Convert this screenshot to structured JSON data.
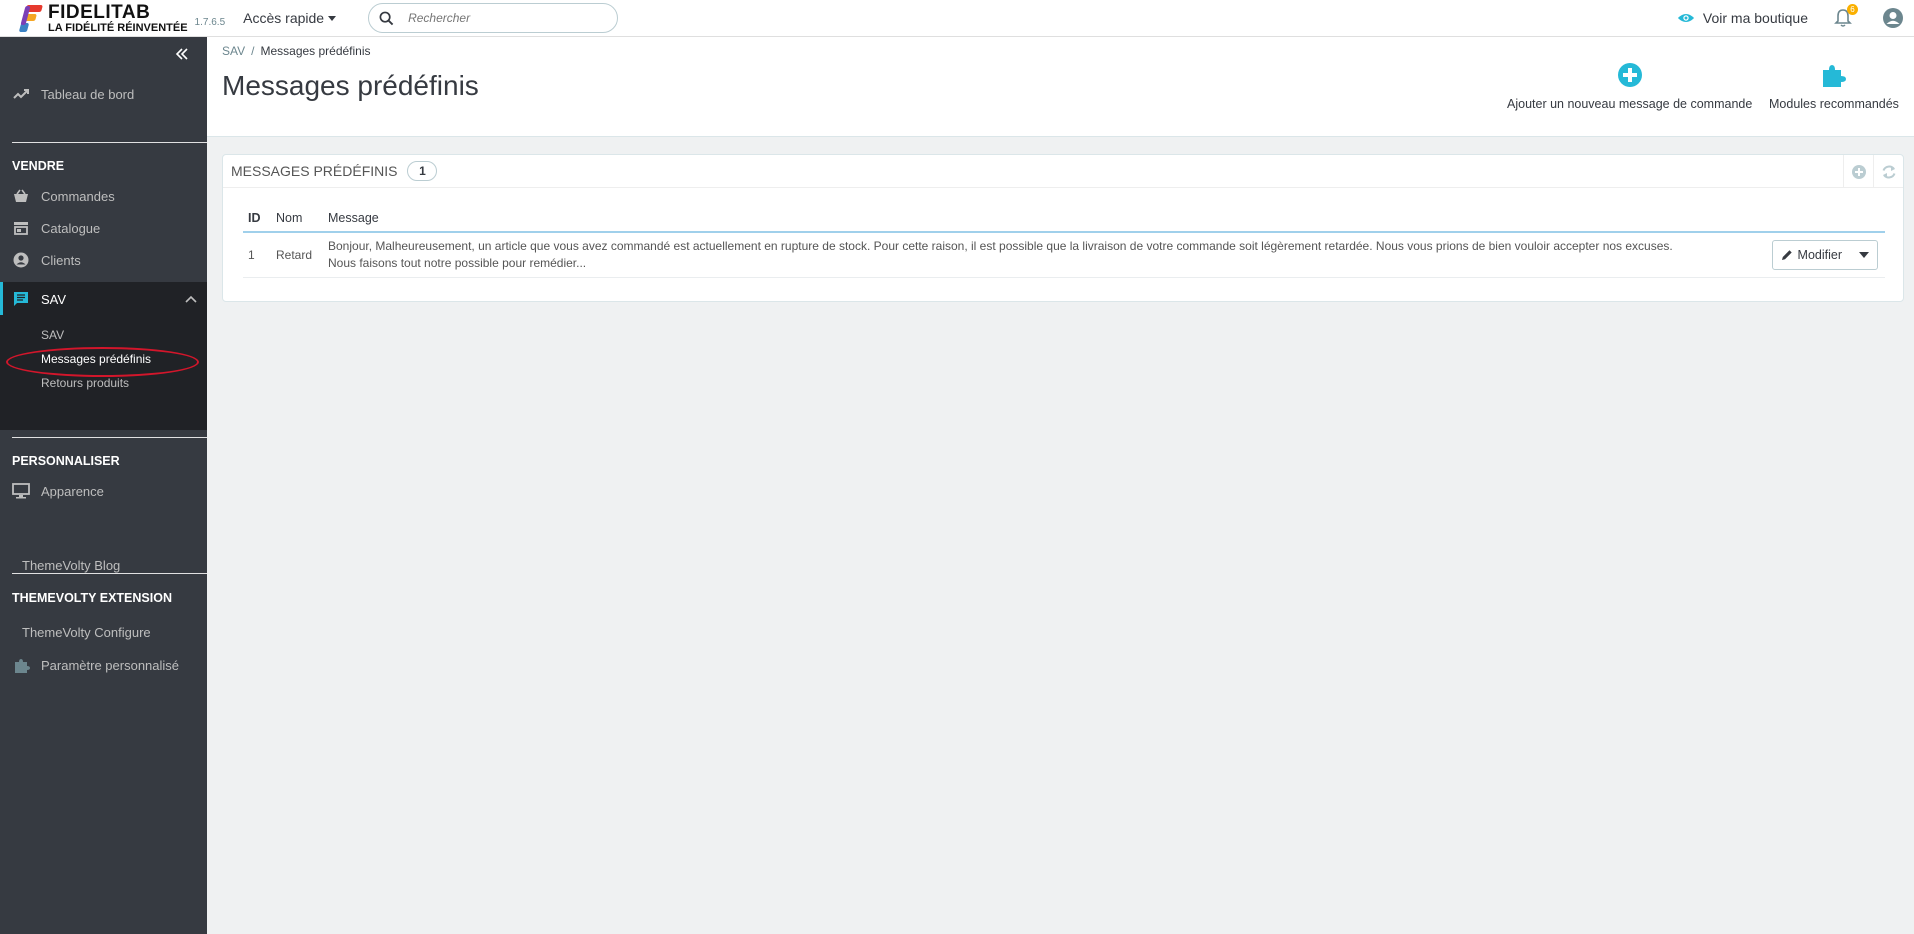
{
  "header": {
    "brand_name": "FIDELITAB",
    "brand_tagline": "LA FIDÉLITÉ RÉINVENTÉE",
    "version": "1.7.6.5",
    "quick_access": "Accès rapide",
    "search_placeholder": "Rechercher",
    "view_shop": "Voir ma boutique",
    "notifications_count": "6"
  },
  "sidebar": {
    "dashboard": "Tableau de bord",
    "section_sell": "VENDRE",
    "orders": "Commandes",
    "catalog": "Catalogue",
    "customers": "Clients",
    "sav": "SAV",
    "sub_sav": "SAV",
    "sub_messages": "Messages prédéfinis",
    "sub_returns": "Retours produits",
    "section_customize": "PERSONNALISER",
    "appearance": "Apparence",
    "themevolty_blog": "ThemeVolty Blog",
    "section_themevolty": "THEMEVOLTY EXTENSION",
    "themevolty_configure": "ThemeVolty Configure",
    "custom_param": "Paramètre personnalisé"
  },
  "page": {
    "breadcrumb_parent": "SAV",
    "breadcrumb_sep": "/",
    "breadcrumb_current": "Messages prédéfinis",
    "title": "Messages prédéfinis",
    "add_button": "Ajouter un nouveau message de commande",
    "modules_button": "Modules recommandés"
  },
  "panel": {
    "title": "MESSAGES PRÉDÉFINIS",
    "count": "1",
    "columns": {
      "id": "ID",
      "name": "Nom",
      "message": "Message"
    },
    "rows": [
      {
        "id": "1",
        "name": "Retard",
        "message_line1": "Bonjour, Malheureusement, un article que vous avez commandé est actuellement en rupture de stock. Pour cette raison, il est possible que la livraison de votre commande soit légèrement retardée. Nous vous prions de bien vouloir accepter nos excuses.",
        "message_line2": "Nous faisons tout notre possible pour remédier...",
        "edit_label": "Modifier"
      }
    ]
  },
  "colors": {
    "accent": "#25b9d7",
    "sidebar_bg": "#363a41",
    "highlight_circle": "#d3162b"
  }
}
